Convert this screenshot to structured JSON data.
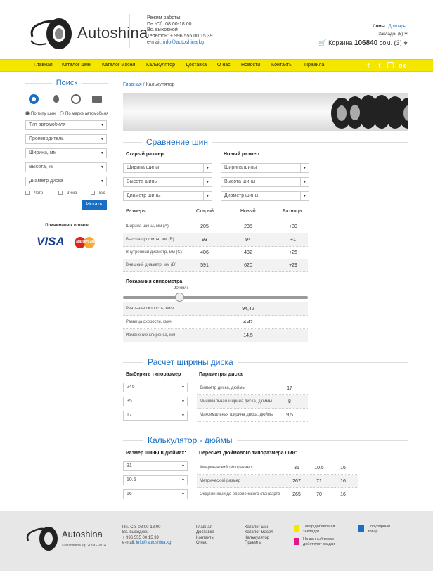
{
  "brand": {
    "name": "Autoshina"
  },
  "contact": {
    "lines": [
      "Режим работы:",
      "Пн.-Сб. 08:00-18:00",
      "Вс. выходной",
      "Телефон: + 996 555 00 15 39"
    ],
    "email_label": "e-mail:",
    "email": "info@autoshina.kg"
  },
  "currency": {
    "active": "Сомы",
    "other": "Доллары"
  },
  "bookmarks": "Закладки (5)",
  "cart": {
    "label": "Корзина",
    "amount": "106840",
    "currency": "сом.",
    "count": "(3)"
  },
  "nav": [
    "Главная",
    "Каталог шин",
    "Каталог масел",
    "Калькулятор",
    "Доставка",
    "О нас",
    "Новости",
    "Контакты",
    "Правила"
  ],
  "social": [
    "f",
    "t",
    "ig",
    "ok"
  ],
  "sidebar": {
    "title": "Поиск",
    "categories": [
      "tire-icon",
      "oil-drop-icon",
      "wheel-disk-icon",
      "battery-icon"
    ],
    "radios": [
      "По типу шин",
      "По марке автомобиля"
    ],
    "selects": [
      "Тип автомобиля",
      "Производитель",
      "Ширина, мм",
      "Высота, %",
      "Диаметр диска"
    ],
    "seasons": [
      "Лето",
      "Зима",
      "В/с"
    ],
    "search_btn": "Искать",
    "payment_title": "Принимаем к оплате",
    "visa": "VISA",
    "mastercard": "MasterCard"
  },
  "breadcrumb": {
    "home": "Главная",
    "sep": "/",
    "current": "Калькулятор"
  },
  "compare": {
    "title": "Сравнение шин",
    "old_label": "Старый размер",
    "new_label": "Новый размер",
    "old_selects": [
      "Ширина шины",
      "Высота шины",
      "Диаметр шины"
    ],
    "new_selects": [
      "Ширина шины",
      "Высота шины",
      "Диаметр шины"
    ],
    "headers": [
      "Размеры",
      "Старый",
      "Новый",
      "Разница"
    ],
    "rows": [
      [
        "Ширина шины, мм (A)",
        "205",
        "235",
        "+30"
      ],
      [
        "Высота профиля, мм (B)",
        "93",
        "94",
        "+1"
      ],
      [
        "Внутренний диаметр, мм (C)",
        "406",
        "432",
        "+26"
      ],
      [
        "Внешний диаметр, мм (D)",
        "591",
        "620",
        "+29"
      ]
    ],
    "speedo_title": "Показания спидометра",
    "speedo_value": "90 км/ч",
    "speedo_level": 0.3,
    "speed_rows": [
      [
        "Реальная скорость, км/ч",
        "94,42"
      ],
      [
        "Разница скорости, км/ч",
        "4,42"
      ],
      [
        "Изменение клиренса, мм",
        "14,5"
      ]
    ]
  },
  "rim": {
    "title": "Расчет ширины диска",
    "select_label": "Выберите типоразмер",
    "params_label": "Параметры диска",
    "selects": [
      "245",
      "35",
      "17"
    ],
    "rows": [
      [
        "Диаметр диска, дюймы",
        "17"
      ],
      [
        "Минимальная ширина диска, дюймы",
        "8"
      ],
      [
        "Максимальная ширина диска, дюймы",
        "9,5"
      ]
    ]
  },
  "inch": {
    "title": "Калькулятор - дюймы",
    "select_label": "Размер шины в дюймах:",
    "conv_label": "Пересчет дюймового типоразмера шин:",
    "selects": [
      "31",
      "10.5",
      "16"
    ],
    "rows": [
      [
        "Американский типоразмер",
        "31",
        "10.5",
        "16"
      ],
      [
        "Метрический размер",
        "267",
        "71",
        "16"
      ],
      [
        "Округленный до европейского стандарта",
        "265",
        "70",
        "16"
      ]
    ]
  },
  "footer": {
    "copyright": "© autoshina.kg, 2009 - 2014",
    "contact": [
      "Пн.-Сб. 08:00-18:00",
      "Вс. выходной",
      "+ 996 555 00 15 39"
    ],
    "email_label": "e-mail:",
    "email": "info@autoshina.kg",
    "links1": [
      "Главная",
      "Доставка",
      "Контакты",
      "О нас"
    ],
    "links2": [
      "Каталог шин",
      "Каталог масел",
      "Калькулятор",
      "Правила"
    ],
    "legend": [
      "Товар добавлен в закладки",
      "На данный товар действуют скидки",
      "Популярный товар"
    ]
  },
  "colors": {
    "accent": "#1a6fc4",
    "nav": "#f5e600"
  }
}
